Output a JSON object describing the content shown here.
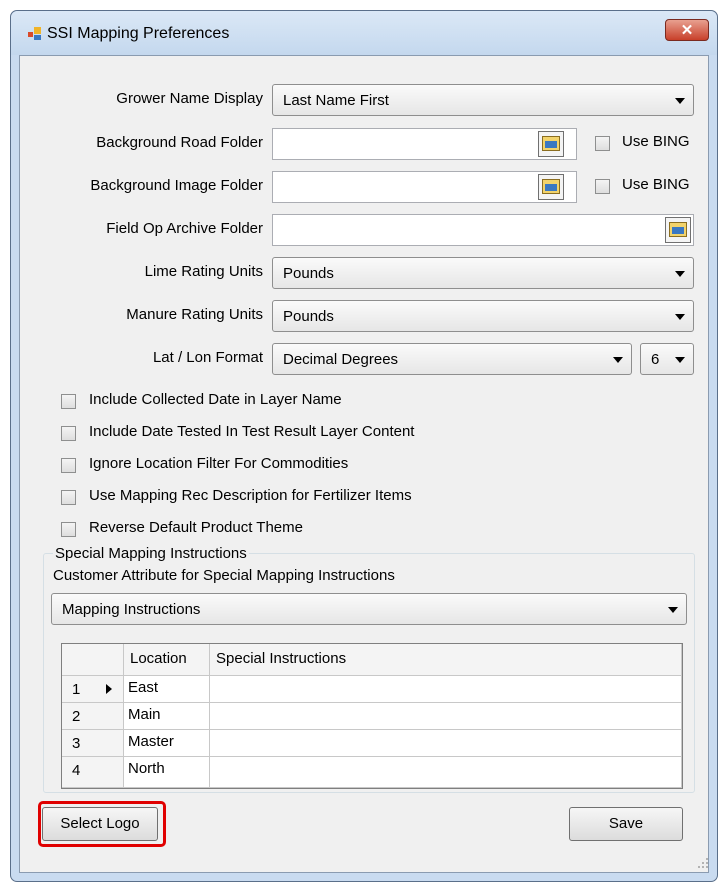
{
  "window": {
    "title": "SSI Mapping Preferences",
    "close_label": "✕"
  },
  "form": {
    "grower_name_display": {
      "label": "Grower Name Display",
      "value": "Last Name First"
    },
    "background_road_folder": {
      "label": "Background Road Folder",
      "value": "",
      "use_bing_label": "Use BING",
      "use_bing_checked": false
    },
    "background_image_folder": {
      "label": "Background Image Folder",
      "value": "",
      "use_bing_label": "Use BING",
      "use_bing_checked": false
    },
    "field_op_archive_folder": {
      "label": "Field Op Archive Folder",
      "value": ""
    },
    "lime_rating_units": {
      "label": "Lime Rating Units",
      "value": "Pounds"
    },
    "manure_rating_units": {
      "label": "Manure Rating Units",
      "value": "Pounds"
    },
    "lat_lon_format": {
      "label": "Lat / Lon Format",
      "value": "Decimal Degrees",
      "precision": "6"
    }
  },
  "options": [
    {
      "label": "Include Collected Date in Layer Name",
      "checked": false
    },
    {
      "label": "Include Date Tested In Test Result Layer Content",
      "checked": false
    },
    {
      "label": "Ignore Location Filter For Commodities",
      "checked": false
    },
    {
      "label": "Use Mapping Rec Description for Fertilizer Items",
      "checked": false
    },
    {
      "label": "Reverse Default Product Theme",
      "checked": false
    }
  ],
  "special": {
    "group_title": "Special Mapping Instructions",
    "attribute_label": "Customer Attribute for Special Mapping Instructions",
    "attribute_value": "Mapping Instructions",
    "columns": [
      "Location",
      "Special Instructions"
    ],
    "rows": [
      {
        "num": "1",
        "location": "East",
        "instructions": ""
      },
      {
        "num": "2",
        "location": "Main",
        "instructions": ""
      },
      {
        "num": "3",
        "location": "Master",
        "instructions": ""
      },
      {
        "num": "4",
        "location": "North",
        "instructions": ""
      }
    ]
  },
  "buttons": {
    "select_logo": "Select Logo",
    "save": "Save"
  },
  "colors": {
    "highlight": "#e00000",
    "window_frame": "#c9dbf0"
  }
}
